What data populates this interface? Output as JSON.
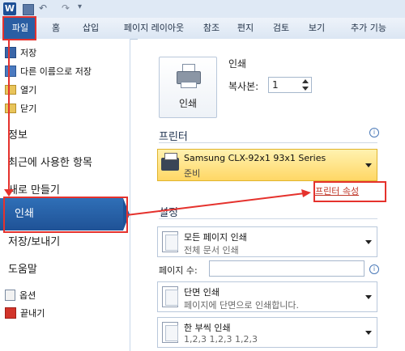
{
  "titlebar": {
    "app_icon_letter": "W"
  },
  "ribbon": {
    "tabs": [
      "파일",
      "홈",
      "삽입",
      "페이지 레이아웃",
      "참조",
      "편지",
      "검토",
      "보기",
      "추가 기능"
    ]
  },
  "left_nav": {
    "save": "저장",
    "save_as": "다른 이름으로 저장",
    "open": "열기",
    "close": "닫기",
    "info": "정보",
    "recent": "최근에 사용한 항목",
    "new": "새로 만들기",
    "print": "인쇄",
    "save_send": "저장/보내기",
    "help": "도움말",
    "options": "옵션",
    "exit": "끝내기"
  },
  "print_panel": {
    "print_button_label": "인쇄",
    "heading": "인쇄",
    "copies_label": "복사본:",
    "copies_value": "1"
  },
  "printer_section": {
    "title": "프린터",
    "printer_name": "Samsung CLX-92x1 93x1 Series",
    "printer_status": "준비",
    "properties_link": "프린터 속성"
  },
  "settings_section": {
    "title": "설정",
    "print_all": {
      "title": "모든 페이지 인쇄",
      "subtitle": "전체 문서 인쇄"
    },
    "pages_label": "페이지 수:",
    "pages_value": "",
    "one_sided": {
      "title": "단면 인쇄",
      "subtitle": "페이지에 단면으로 인쇄합니다."
    },
    "collated": {
      "title": "한 부씩 인쇄",
      "subtitle": "1,2,3    1,2,3    1,2,3"
    }
  },
  "colors": {
    "accent_blue": "#1f5296",
    "annotation_red": "#e5322d",
    "printer_highlight": "#ffd765"
  }
}
